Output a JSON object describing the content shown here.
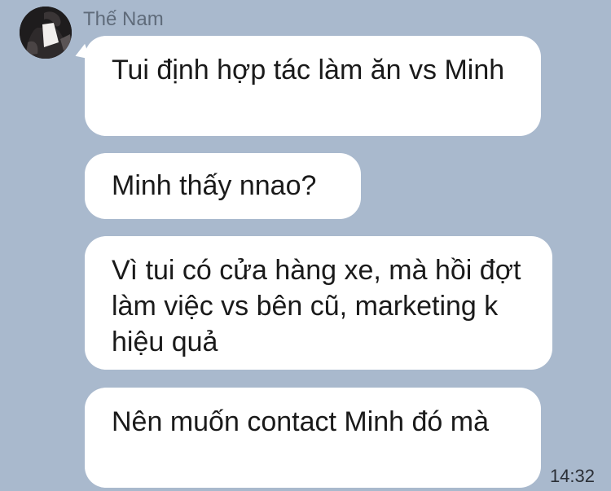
{
  "chat": {
    "sender_name": "Thế Nam",
    "avatar": "user-avatar-photo",
    "messages": [
      {
        "text": "Tui định hợp tác làm ăn vs Minh"
      },
      {
        "text": "Minh thấy nnao?"
      },
      {
        "text": "Vì tui có cửa hàng xe, mà hồi đợt làm việc vs bên cũ, marketing k hiệu quả"
      },
      {
        "text": "Nên muốn contact Minh đó mà"
      }
    ],
    "timestamp": "14:32"
  },
  "colors": {
    "background": "#a9b9cd",
    "bubble": "#ffffff",
    "sender_name": "#5f6b7a",
    "text": "#1a1a1a"
  }
}
